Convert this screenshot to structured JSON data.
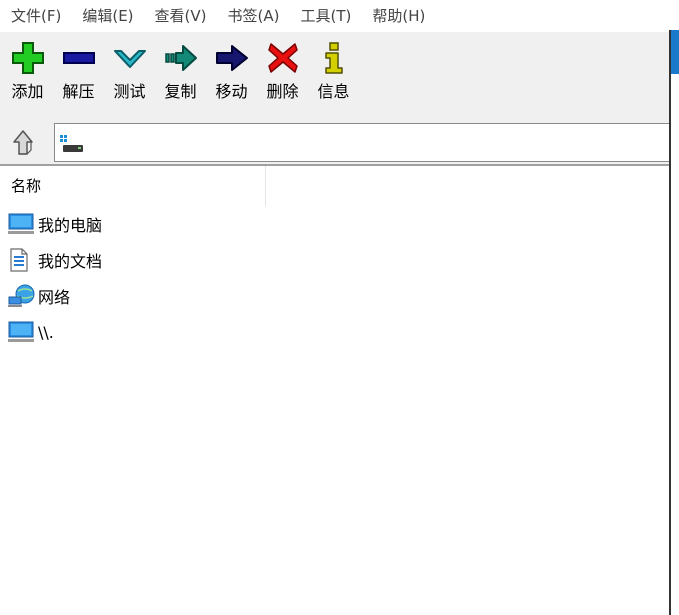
{
  "menu": {
    "file": "文件(F)",
    "edit": "编辑(E)",
    "view": "查看(V)",
    "bookmarks": "书签(A)",
    "tools": "工具(T)",
    "help": "帮助(H)"
  },
  "toolbar": {
    "add": "添加",
    "extract": "解压",
    "test": "测试",
    "copy": "复制",
    "move": "移动",
    "delete": "删除",
    "info": "信息"
  },
  "address": {
    "value": ""
  },
  "columns": {
    "name": "名称"
  },
  "items": [
    {
      "label": "我的电脑",
      "icon": "computer-icon"
    },
    {
      "label": "我的文档",
      "icon": "document-icon"
    },
    {
      "label": "网络",
      "icon": "network-icon"
    },
    {
      "label": "\\\\.",
      "icon": "computer-icon"
    }
  ],
  "colors": {
    "add_icon": "#22cc22",
    "extract_icon": "#1a1aa0",
    "test_icon": "#29b8c8",
    "copy_icon": "#138a78",
    "move_icon": "#16166e",
    "delete_icon": "#e81010",
    "info_icon": "#d4d000"
  }
}
